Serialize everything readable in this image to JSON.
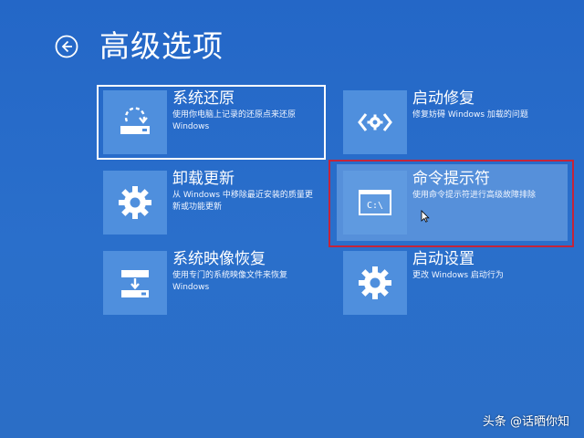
{
  "header": {
    "title": "高级选项"
  },
  "options": [
    {
      "title": "系统还原",
      "desc": "使用你电脑上记录的还原点来还原 Windows",
      "icon": "system-restore-icon"
    },
    {
      "title": "卸载更新",
      "desc": "从 Windows 中移除最近安装的质量更新或功能更新",
      "icon": "gear-icon"
    },
    {
      "title": "系统映像恢复",
      "desc": "使用专门的系统映像文件来恢复 Windows",
      "icon": "image-recovery-icon"
    },
    {
      "title": "启动修复",
      "desc": "修复妨碍 Windows 加载的问题",
      "icon": "code-brackets-icon"
    },
    {
      "title": "命令提示符",
      "desc": "使用命令提示符进行高级故障排除",
      "icon": "command-prompt-icon",
      "highlighted": true
    },
    {
      "title": "启动设置",
      "desc": "更改 Windows 启动行为",
      "icon": "gear-icon"
    }
  ],
  "watermark": "头条 @话晒你知",
  "colors": {
    "background": "#2268c6",
    "tile": "#4f8fdd",
    "highlight_border": "#c4243a",
    "selection_border": "#ffffff"
  }
}
